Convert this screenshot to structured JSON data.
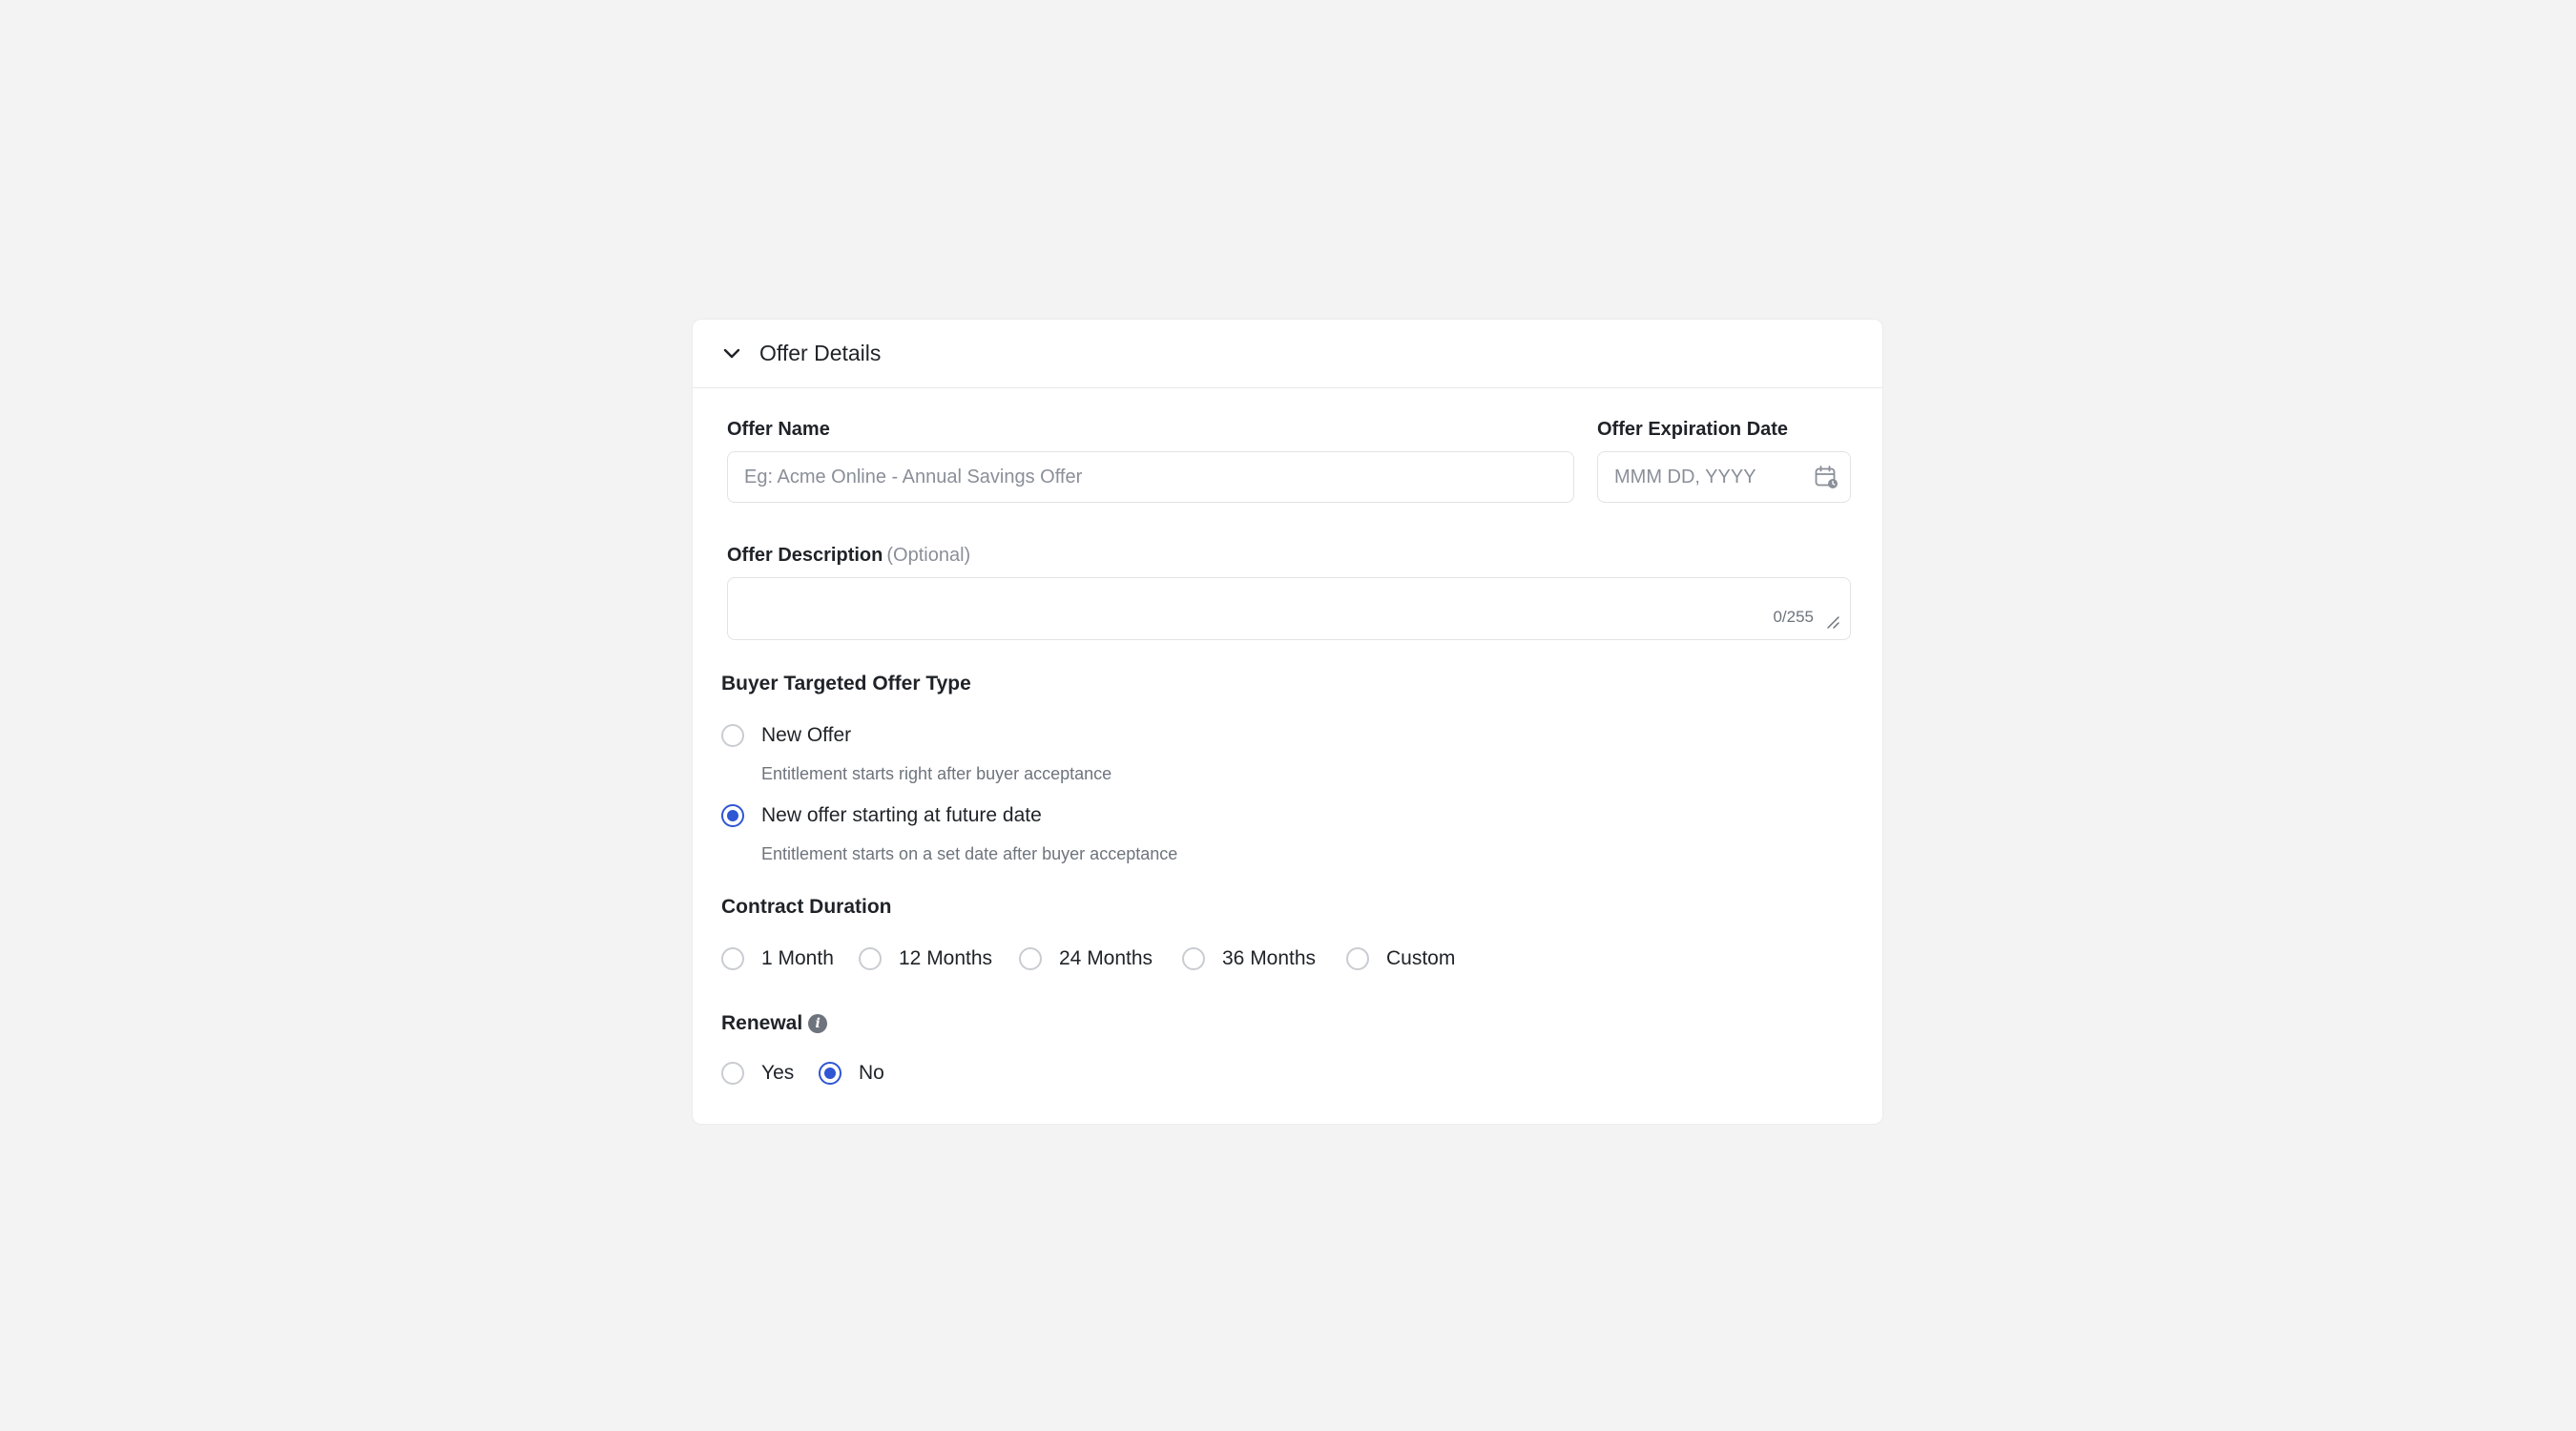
{
  "section": {
    "title": "Offer Details"
  },
  "offer_name": {
    "label": "Offer Name",
    "placeholder": "Eg: Acme Online - Annual Savings Offer",
    "value": ""
  },
  "offer_expiration": {
    "label": "Offer Expiration Date",
    "placeholder": "MMM DD, YYYY",
    "value": "",
    "icon": "calendar-icon"
  },
  "offer_description": {
    "label": "Offer Description",
    "optional": "(Optional)",
    "value": "",
    "counter": "0/255"
  },
  "buyer_type": {
    "title": "Buyer Targeted Offer Type",
    "options": [
      {
        "label": "New Offer",
        "description": "Entitlement starts right after buyer acceptance",
        "checked": false
      },
      {
        "label": "New offer starting at future date",
        "description": "Entitlement starts on a set date after buyer acceptance",
        "checked": true
      }
    ]
  },
  "contract_duration": {
    "title": "Contract Duration",
    "options": [
      {
        "label": "1 Month",
        "checked": false
      },
      {
        "label": "12 Months",
        "checked": false
      },
      {
        "label": "24 Months",
        "checked": false
      },
      {
        "label": "36 Months",
        "checked": false
      },
      {
        "label": "Custom",
        "checked": false
      }
    ]
  },
  "renewal": {
    "title": "Renewal",
    "info_icon": "info-icon",
    "options": [
      {
        "label": "Yes",
        "checked": false
      },
      {
        "label": "No",
        "checked": true
      }
    ]
  },
  "colors": {
    "accent": "#2f56d3",
    "background": "#f3f3f3",
    "card": "#ffffff"
  }
}
